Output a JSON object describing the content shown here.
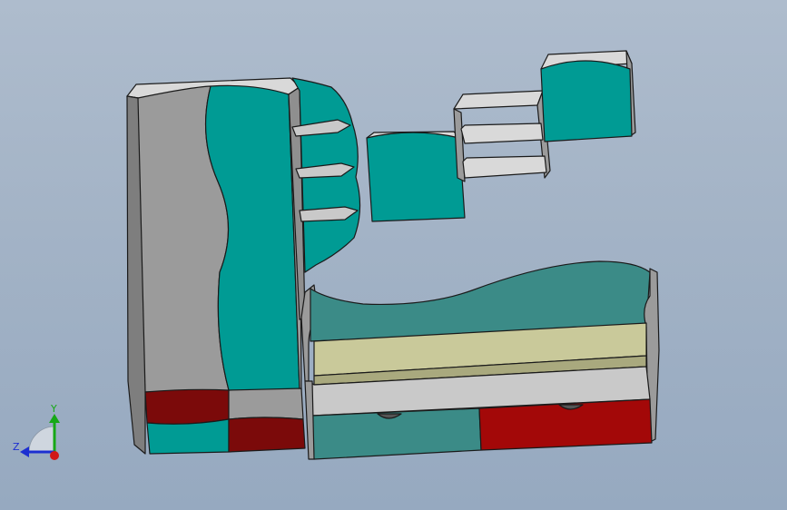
{
  "viewport": {
    "background_top": "#aebccd",
    "background_bottom": "#96a9c0"
  },
  "model": {
    "colors": {
      "teal": "#009b94",
      "teal_dark": "#3b8b87",
      "teal_shadow": "#007873",
      "gray_side": "#9b9b9b",
      "gray_face": "#c9c9c9",
      "gray_light": "#d9d9d9",
      "gray_dark": "#7a7a7a",
      "maroon": "#7b0a0a",
      "red": "#a30808",
      "mattress": "#c9c99a",
      "mattress_side": "#a9a97e",
      "outline": "#1a1a1a"
    }
  },
  "triad": {
    "y_label": "Y",
    "z_label": "Z",
    "y_color": "#16a816",
    "z_color": "#1c2fd1",
    "x_color": "#d01818"
  }
}
